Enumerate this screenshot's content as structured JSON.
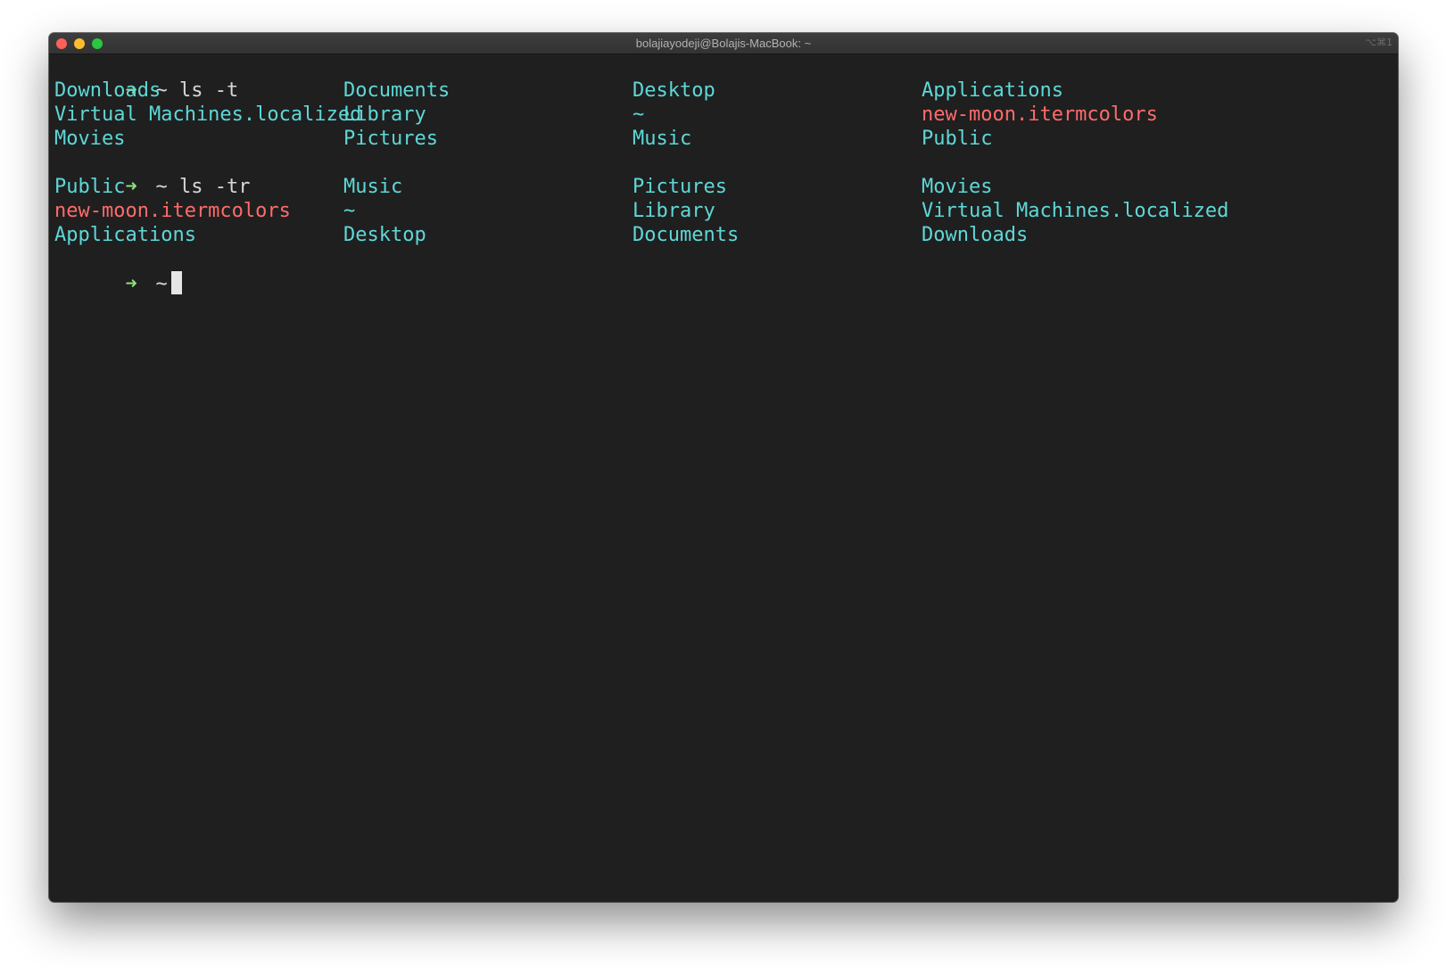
{
  "window": {
    "title": "bolajiayodeji@Bolajis-MacBook: ~",
    "shortcut": "⌥⌘1"
  },
  "prompt": {
    "arrow": "➜",
    "cwd": "~"
  },
  "commands": [
    {
      "cmd": "ls -t",
      "rows": [
        [
          {
            "name": "Downloads",
            "kind": "dir"
          },
          {
            "name": "Documents",
            "kind": "dir"
          },
          {
            "name": "Desktop",
            "kind": "dir"
          },
          {
            "name": "Applications",
            "kind": "dir"
          }
        ],
        [
          {
            "name": "Virtual Machines.localized",
            "kind": "dir"
          },
          {
            "name": "Library",
            "kind": "dir"
          },
          {
            "name": "~",
            "kind": "dir"
          },
          {
            "name": "new-moon.itermcolors",
            "kind": "file"
          }
        ],
        [
          {
            "name": "Movies",
            "kind": "dir"
          },
          {
            "name": "Pictures",
            "kind": "dir"
          },
          {
            "name": "Music",
            "kind": "dir"
          },
          {
            "name": "Public",
            "kind": "dir"
          }
        ]
      ]
    },
    {
      "cmd": "ls -tr",
      "rows": [
        [
          {
            "name": "Public",
            "kind": "dir"
          },
          {
            "name": "Music",
            "kind": "dir"
          },
          {
            "name": "Pictures",
            "kind": "dir"
          },
          {
            "name": "Movies",
            "kind": "dir"
          }
        ],
        [
          {
            "name": "new-moon.itermcolors",
            "kind": "file"
          },
          {
            "name": "~",
            "kind": "dir"
          },
          {
            "name": "Library",
            "kind": "dir"
          },
          {
            "name": "Virtual Machines.localized",
            "kind": "dir"
          }
        ],
        [
          {
            "name": "Applications",
            "kind": "dir"
          },
          {
            "name": "Desktop",
            "kind": "dir"
          },
          {
            "name": "Documents",
            "kind": "dir"
          },
          {
            "name": "Downloads",
            "kind": "dir"
          }
        ]
      ]
    }
  ],
  "colors": {
    "background": "#1f1f1f",
    "prompt_arrow": "#8ee07f",
    "directory": "#5fd7d7",
    "file": "#ff6b6b",
    "text": "#d7d7d7"
  }
}
